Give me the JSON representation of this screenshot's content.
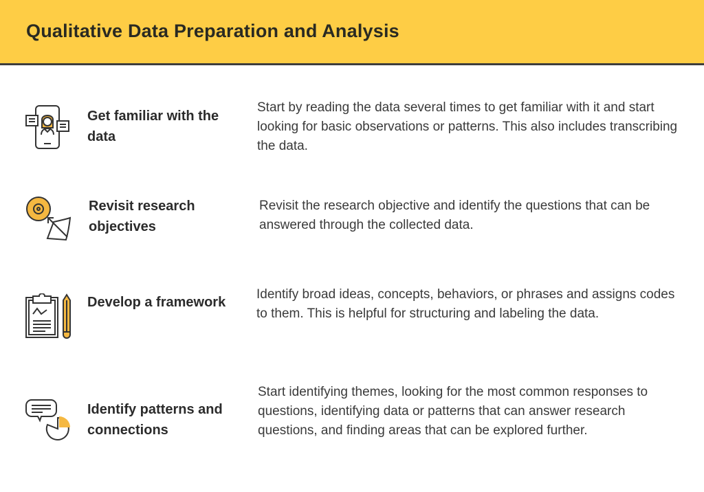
{
  "header": {
    "title": "Qualitative Data Preparation and Analysis",
    "background_color": "#fecd45",
    "accent_color": "#f5b841"
  },
  "steps": [
    {
      "icon": "smartphone-person-icon",
      "title": "Get familiar with the data",
      "description": "Start by reading the data several times to get familiar with it and start looking for basic observations or patterns. This also includes transcribing the data."
    },
    {
      "icon": "target-arrow-icon",
      "title": "Revisit research objectives",
      "description": "Revisit the research objective and identify the questions that can be answered through the collected data."
    },
    {
      "icon": "clipboard-pencil-icon",
      "title": "Develop a framework",
      "description": "Identify broad ideas, concepts, behaviors, or phrases and assigns codes to them. This is helpful for structuring and labeling the data."
    },
    {
      "icon": "speech-bubble-pie-chart-icon",
      "title": "Identify patterns and connections",
      "description": "Start identifying themes, looking for the most common responses to questions, identifying data or patterns that can answer research questions, and finding areas that can be explored further."
    }
  ]
}
